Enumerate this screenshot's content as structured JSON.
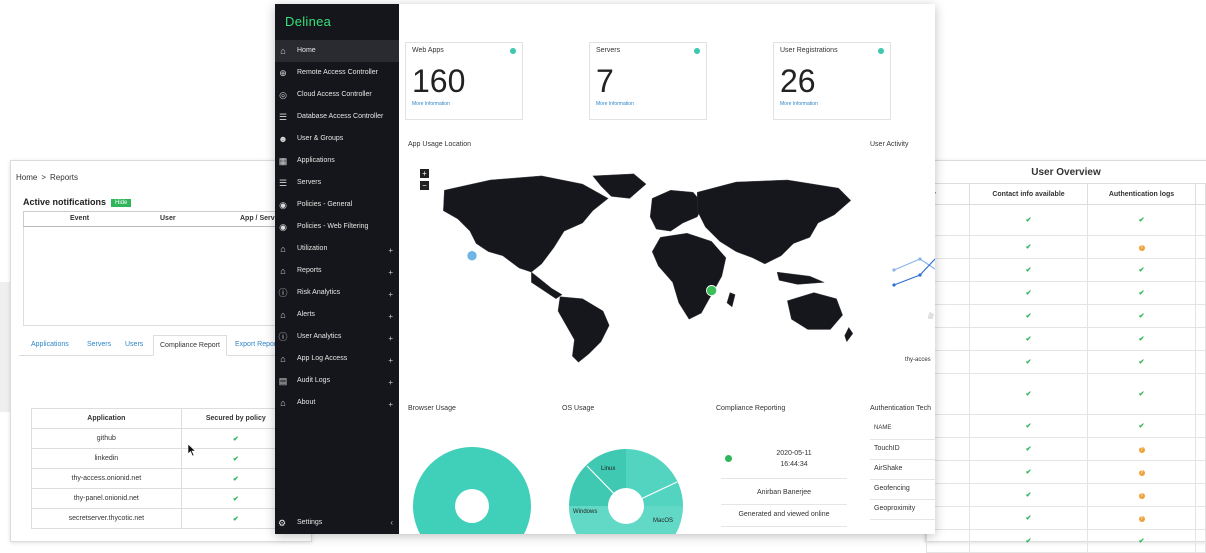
{
  "reports": {
    "breadcrumb": [
      "Home",
      "Reports"
    ],
    "breadcrumb_sep": ">",
    "active_notifications": "Active notifications",
    "badge": "Hide",
    "notif_headers": [
      "Event",
      "User",
      "App / Server"
    ],
    "tabs": [
      "Applications",
      "Servers",
      "Users",
      "Compliance Report",
      "Export Report"
    ],
    "active_tab": "Compliance Report",
    "table_headers": [
      "Application",
      "Secured by policy"
    ],
    "table_rows": [
      {
        "app": "github",
        "check": "✔"
      },
      {
        "app": "linkedin",
        "check": "✔"
      },
      {
        "app": "thy-access.onionid.net",
        "check": "✔"
      },
      {
        "app": "thy-panel.onionid.net",
        "check": "✔"
      },
      {
        "app": "secretserver.thycotic.net",
        "check": "✔"
      }
    ]
  },
  "overview": {
    "title": "User Overview",
    "col0": "cy",
    "headers": [
      "Contact info available",
      "Authentication logs"
    ]
  },
  "sidebar": {
    "logo": "Delinea",
    "items": [
      {
        "label": "Home",
        "icon": "home-icon",
        "glyph": "⌂",
        "plus": ""
      },
      {
        "label": "Remote Access Controller",
        "icon": "globe-icon",
        "glyph": "⊕",
        "plus": ""
      },
      {
        "label": "Cloud Access Controller",
        "icon": "cloud-icon",
        "glyph": "◎",
        "plus": ""
      },
      {
        "label": "Database Access Controller",
        "icon": "database-icon",
        "glyph": "☰",
        "plus": ""
      },
      {
        "label": "User & Groups",
        "icon": "users-icon",
        "glyph": "☻",
        "plus": ""
      },
      {
        "label": "Applications",
        "icon": "grid-icon",
        "glyph": "▦",
        "plus": ""
      },
      {
        "label": "Servers",
        "icon": "server-icon",
        "glyph": "☰",
        "plus": ""
      },
      {
        "label": "Policies - General",
        "icon": "shield-icon",
        "glyph": "◉",
        "plus": ""
      },
      {
        "label": "Policies - Web Filtering",
        "icon": "shield-icon",
        "glyph": "◉",
        "plus": ""
      },
      {
        "label": "Utilization",
        "icon": "home-icon",
        "glyph": "⌂",
        "plus": "+"
      },
      {
        "label": "Reports",
        "icon": "home-icon",
        "glyph": "⌂",
        "plus": "+"
      },
      {
        "label": "Risk Analytics",
        "icon": "alert-circle-icon",
        "glyph": "ⓘ",
        "plus": "+"
      },
      {
        "label": "Alerts",
        "icon": "home-icon",
        "glyph": "⌂",
        "plus": "+"
      },
      {
        "label": "User Analytics",
        "icon": "alert-circle-icon",
        "glyph": "ⓘ",
        "plus": "+"
      },
      {
        "label": "App Log Access",
        "icon": "home-icon",
        "glyph": "⌂",
        "plus": "+"
      },
      {
        "label": "Audit Logs",
        "icon": "log-icon",
        "glyph": "▤",
        "plus": "+"
      },
      {
        "label": "About",
        "icon": "home-icon",
        "glyph": "⌂",
        "plus": "+"
      }
    ],
    "settings": "Settings"
  },
  "cards": [
    {
      "title": "Web Apps",
      "value": "160",
      "link": "More Information"
    },
    {
      "title": "Servers",
      "value": "7",
      "link": "More Information"
    },
    {
      "title": "User Registrations",
      "value": "26",
      "link": "More Information"
    }
  ],
  "sections": {
    "map": "App Usage Location",
    "activity": "User Activity",
    "activity_label": "thy-acces",
    "browser": "Browser Usage",
    "os": "OS Usage",
    "compliance": "Compliance Reporting",
    "auth": "Authentication Tech"
  },
  "os_labels": {
    "linux": "Linux",
    "windows": "Windows",
    "macos": "MacOS"
  },
  "compliance": {
    "date": "2020-05-11",
    "time": "16:44:34",
    "user": "Anirban Banerjee",
    "status": "Generated and viewed online"
  },
  "auth_rows": [
    "NAME",
    "TouchID",
    "AirShake",
    "Geofencing",
    "Geoproximity"
  ],
  "colors": {
    "accent": "#37e07a",
    "teal": "#3cc7b0",
    "sidebar": "#15161b",
    "link": "#2f86c9"
  }
}
